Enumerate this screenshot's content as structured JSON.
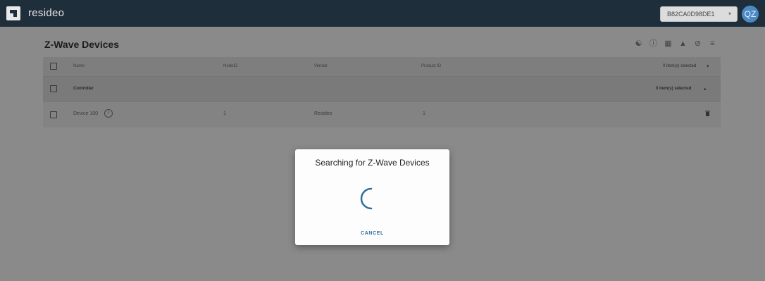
{
  "header": {
    "brand": "resideo",
    "device_id": "B82CA0D98DE1",
    "avatar_initials": "QZ"
  },
  "page": {
    "title": "Z-Wave Devices",
    "toolbar_icons": [
      "radio-signal-icon",
      "info-icon",
      "factory-icon",
      "graduation-cap-icon",
      "block-icon",
      "playlist-add-icon"
    ]
  },
  "table": {
    "columns": [
      "Name",
      "NodeID",
      "Vendor",
      "Product ID"
    ],
    "header_selected": "0 item(s) selected",
    "group": {
      "name": "Controller",
      "selected": "0 item(s) selected"
    },
    "rows": [
      {
        "name": "Device 100",
        "node_id": "1",
        "vendor": "Resideo",
        "product_id": "1"
      }
    ]
  },
  "dialog": {
    "title": "Searching for Z-Wave Devices",
    "cancel_label": "CANCEL"
  },
  "colors": {
    "topbar": "#1f2e3b",
    "avatar": "#4a89c4",
    "spinner": "#2f6f9b",
    "accent": "#2f6f9b"
  }
}
